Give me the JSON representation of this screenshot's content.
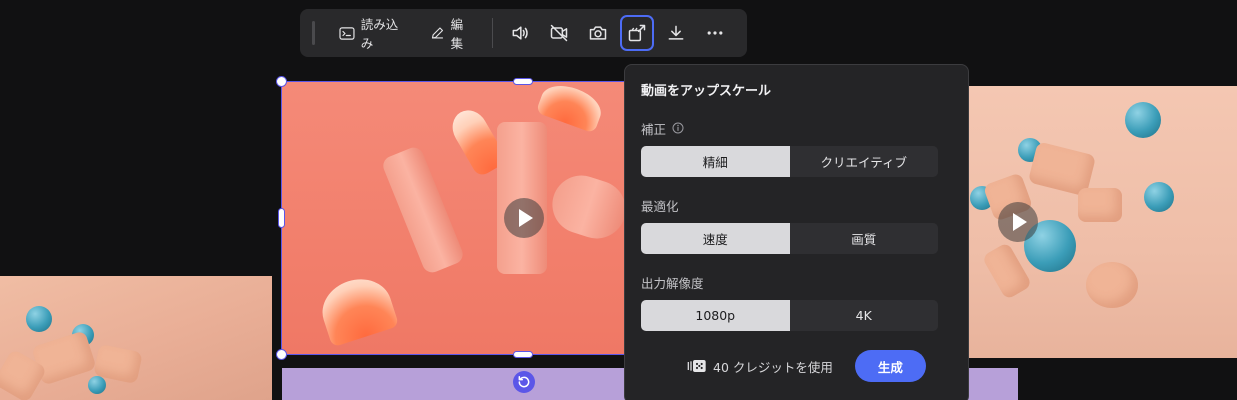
{
  "toolbar": {
    "import_label": "読み込み",
    "edit_label": "編集",
    "icons": [
      "terminal-icon",
      "pencil-icon",
      "volume-icon",
      "video-off-icon",
      "camera-icon",
      "upscale-icon",
      "download-icon",
      "more-icon"
    ]
  },
  "upscale_panel": {
    "title": "動画をアップスケール",
    "correction": {
      "label": "補正",
      "options": [
        "精細",
        "クリエイティブ"
      ],
      "selected": "精細"
    },
    "optimization": {
      "label": "最適化",
      "options": [
        "速度",
        "画質"
      ],
      "selected": "速度"
    },
    "resolution": {
      "label": "出力解像度",
      "options": [
        "1080p",
        "4K"
      ],
      "selected": "1080p"
    },
    "credits_text": "40 クレジットを使用",
    "generate_label": "生成"
  },
  "colors": {
    "accent": "#4d6cf5",
    "selection": "#5b56e8",
    "panel_bg": "#242426"
  }
}
